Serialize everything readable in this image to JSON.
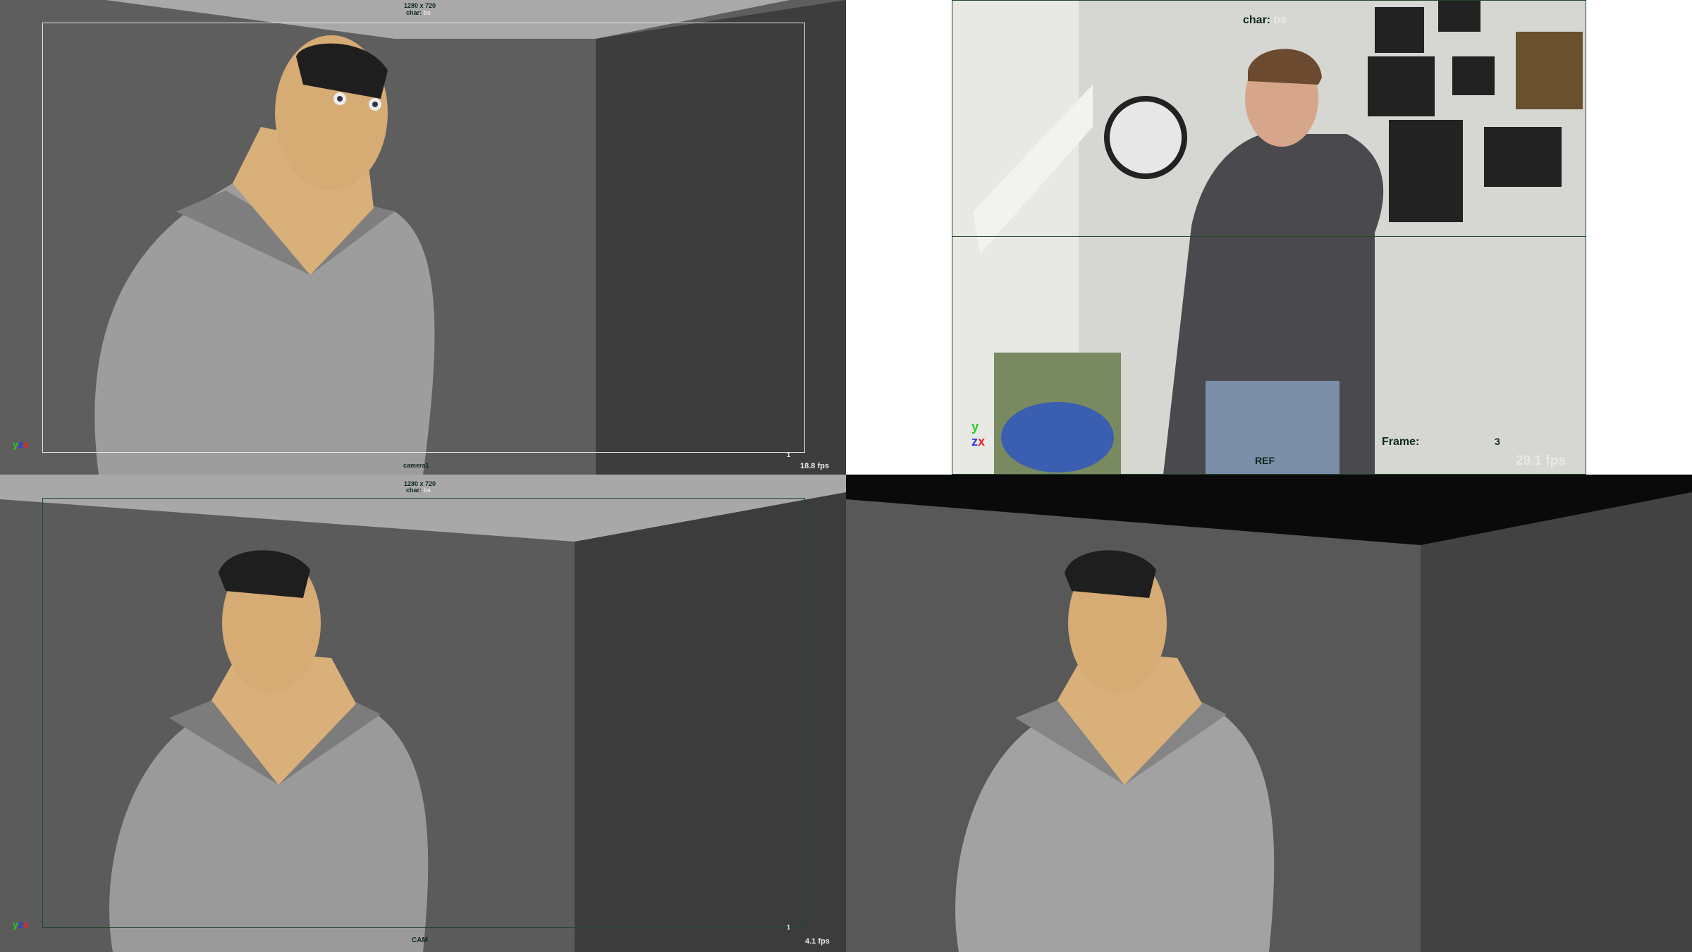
{
  "viewports": {
    "top_left": {
      "resolution": "1280 x 720",
      "char_label": "char:",
      "char_value": "bs",
      "camera_label": "camera1",
      "frame_marker": "1",
      "fps": "18.8 fps",
      "axes": [
        "y",
        "z",
        "x"
      ]
    },
    "top_right": {
      "char_label": "char:",
      "char_value": "bs",
      "ref_label": "REF",
      "frame_label": "Frame:",
      "frame_value": "3",
      "fps": "29.1 fps",
      "axes": [
        "y",
        "z",
        "x"
      ]
    },
    "bottom_left": {
      "resolution": "1280 x 720",
      "char_label": "char:",
      "char_value": "bs",
      "camera_label": "CAM",
      "frame_marker": "1",
      "fps": "4.1 fps",
      "axes": [
        "y",
        "z",
        "x"
      ]
    },
    "bottom_right": {}
  },
  "colors": {
    "hud_text": "#0d2a1a",
    "gate_light": "#e6e6e6",
    "gate_dark": "#1d4a2c",
    "skin": "#d9b07a",
    "shirt": "#9a9a9a"
  }
}
